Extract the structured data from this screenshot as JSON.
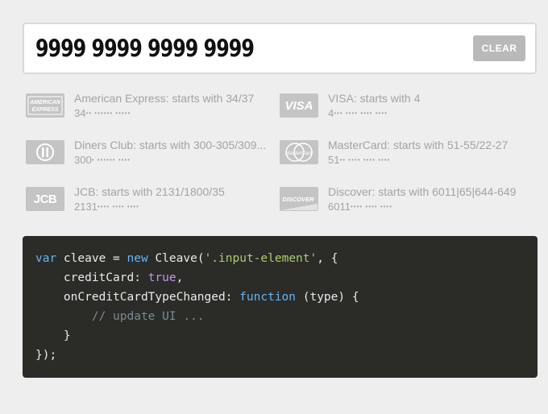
{
  "input": {
    "value": "9999 9999 9999 9999",
    "placeholder": ""
  },
  "clear_button": {
    "label": "CLEAR"
  },
  "cards": [
    {
      "logo": "AMERICAN EXPRESS",
      "icon": "amex-logo-icon",
      "description": "American Express: starts with 34/37",
      "mask_prefix": "34",
      "mask_dots": "•• •••••• •••••"
    },
    {
      "logo": "VISA",
      "icon": "visa-logo-icon",
      "description": "VISA: starts with 4",
      "mask_prefix": "4",
      "mask_dots": "••• •••• •••• ••••"
    },
    {
      "logo": "",
      "icon": "diners-club-logo-icon",
      "description": "Diners Club: starts with 300-305/309...",
      "mask_prefix": "300",
      "mask_dots": "• •••••• ••••"
    },
    {
      "logo": "MasterCard",
      "icon": "mastercard-logo-icon",
      "description": "MasterCard: starts with 51-55/22-27",
      "mask_prefix": "51",
      "mask_dots": "•• •••• •••• ••••"
    },
    {
      "logo": "JCB",
      "icon": "jcb-logo-icon",
      "description": "JCB: starts with 2131/1800/35",
      "mask_prefix": "2131",
      "mask_dots": "•••• •••• ••••"
    },
    {
      "logo": "DISCOVER",
      "icon": "discover-logo-icon",
      "description": "Discover: starts with 6011|65|644-649",
      "mask_prefix": "6011",
      "mask_dots": "•••• •••• ••••"
    }
  ],
  "code": {
    "line1": {
      "kw_var": "var",
      "text1": " cleave = ",
      "kw_new": "new",
      "text2": " Cleave(",
      "str": "'.input-element'",
      "text3": ", {"
    },
    "line2": {
      "key": "    creditCard: ",
      "bool": "true",
      "end": ","
    },
    "line3": {
      "key": "    onCreditCardTypeChanged: ",
      "kw_fn": "function",
      "end": " (type) {"
    },
    "line4": {
      "comment": "        // update UI ..."
    },
    "line5": {
      "text": "    }"
    },
    "line6": {
      "text": "});"
    }
  },
  "colors": {
    "background": "#eeeeee",
    "code_bg": "#2b2b28",
    "keyword": "#64b5f6",
    "string": "#a8d06a",
    "boolean": "#c792ea",
    "comment": "#7c8a94",
    "muted": "#a3a3a3"
  }
}
